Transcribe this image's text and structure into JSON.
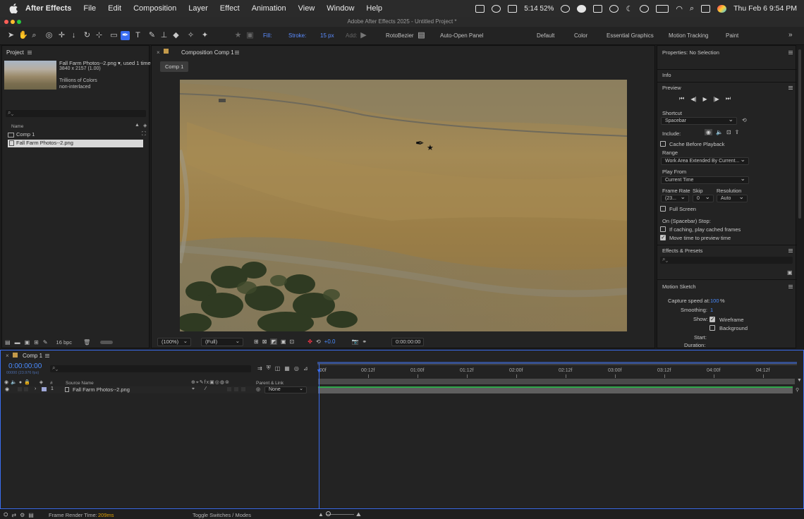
{
  "menubar": {
    "app": "After Effects",
    "items": [
      "File",
      "Edit",
      "Composition",
      "Layer",
      "Effect",
      "Animation",
      "View",
      "Window",
      "Help"
    ],
    "battery_text": "5:14 52%",
    "datetime": "Thu Feb 6  9:54 PM"
  },
  "window": {
    "title": "Adobe After Effects 2025 - Untitled Project *"
  },
  "toolbar": {
    "fill_label": "Fill:",
    "stroke_label": "Stroke:",
    "stroke_width": "15 px",
    "add_label": "Add:",
    "rotobezier_label": "RotoBezier",
    "auto_open_label": "Auto-Open Panel",
    "workspaces": [
      "Default",
      "Color",
      "Essential Graphics",
      "Motion Tracking",
      "Paint"
    ],
    "fill_color": "#1f3fe0",
    "stroke_color": "#f2c21a"
  },
  "project": {
    "title": "Project",
    "selected_name": "Fall Farm Photos--2.png",
    "used": ", used 1 time",
    "dimensions": "3840 x 2157 (1.00)",
    "colors": "Trillions of Colors",
    "interlace": "non-interlaced",
    "name_col": "Name",
    "items": [
      {
        "name": "Comp 1"
      },
      {
        "name": "Fall Farm Photos--2.png"
      }
    ],
    "bpc": "16 bpc"
  },
  "comp": {
    "title": "Composition Comp 1",
    "tab": "Comp 1",
    "zoom": "(100%)",
    "resolution": "(Full)",
    "exposure": "+0.0",
    "timecode": "0:00:00:00"
  },
  "right": {
    "properties": "Properties: No Selection",
    "info": "Info",
    "preview": "Preview",
    "shortcut_label": "Shortcut",
    "shortcut_value": "Spacebar",
    "include_label": "Include:",
    "cache_label": "Cache Before Playback",
    "range_label": "Range",
    "range_value": "Work Area Extended By Current...",
    "play_from_label": "Play From",
    "play_from_value": "Current Time",
    "frame_rate_label": "Frame Rate",
    "skip_label": "Skip",
    "resolution_label": "Resolution",
    "frame_rate_value": "(23...",
    "skip_value": "0",
    "resolution_value": "Auto",
    "fullscreen_label": "Full Screen",
    "on_stop_label": "On (Spacebar) Stop:",
    "if_caching_label": "If caching, play cached frames",
    "move_time_label": "Move time to preview time",
    "effects_presets": "Effects & Presets",
    "motion_sketch": "Motion Sketch",
    "capture_label": "Capture speed at:",
    "capture_value": "100",
    "capture_unit": "%",
    "smoothing_label": "Smoothing:",
    "smoothing_value": "1",
    "show_label": "Show:",
    "wireframe_label": "Wireframe",
    "background_label": "Background",
    "start_label": "Start:",
    "duration_label": "Duration:"
  },
  "timeline": {
    "tab": "Comp 1",
    "timecode": "0:00:00:00",
    "fps": "00000 (23.976 fps)",
    "col_num": "#",
    "col_source": "Source Name",
    "col_parent": "Parent & Link",
    "ruler": [
      "00f",
      "00:12f",
      "01:00f",
      "01:12f",
      "02:00f",
      "02:12f",
      "03:00f",
      "03:12f",
      "04:00f",
      "04:12f"
    ],
    "layer": {
      "num": "1",
      "name": "Fall Farm Photos--2.png",
      "parent": "None"
    }
  },
  "status": {
    "render_label": "Frame Render Time:",
    "render_value": "209ms",
    "toggle": "Toggle Switches / Modes"
  }
}
